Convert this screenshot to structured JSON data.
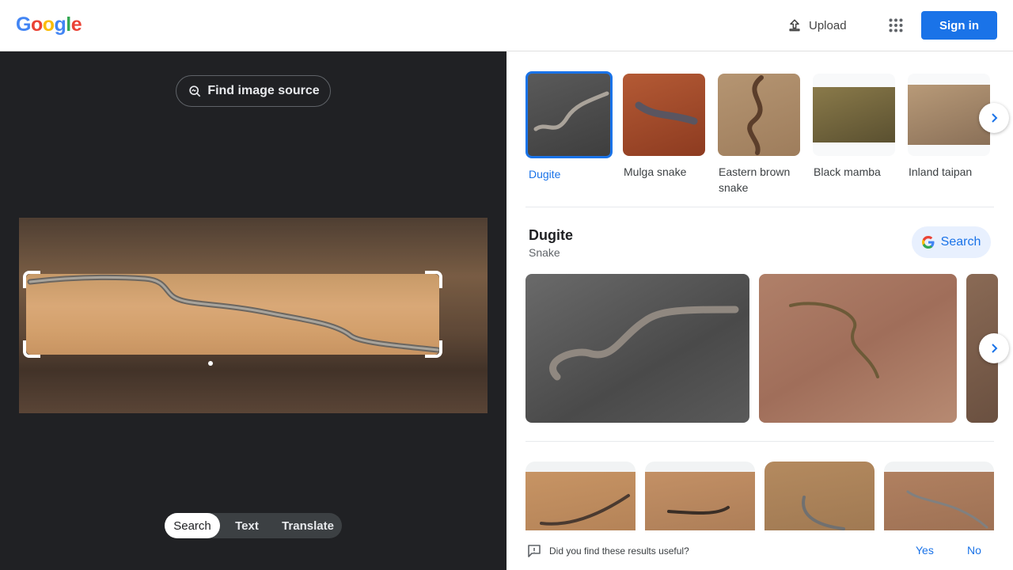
{
  "header": {
    "logo_letters": [
      {
        "char": "G",
        "color": "#4285f4"
      },
      {
        "char": "o",
        "color": "#ea4335"
      },
      {
        "char": "o",
        "color": "#fbbc05"
      },
      {
        "char": "g",
        "color": "#4285f4"
      },
      {
        "char": "l",
        "color": "#34a853"
      },
      {
        "char": "e",
        "color": "#ea4335"
      }
    ],
    "upload_label": "Upload",
    "signin_label": "Sign in"
  },
  "left_panel": {
    "find_source_label": "Find image source",
    "modes": [
      {
        "label": "Search",
        "active": true
      },
      {
        "label": "Text",
        "active": false
      },
      {
        "label": "Translate",
        "active": false
      }
    ]
  },
  "top_matches": [
    {
      "label": "Dugite",
      "selected": true
    },
    {
      "label": "Mulga snake",
      "selected": false
    },
    {
      "label": "Eastern brown snake",
      "selected": false
    },
    {
      "label": "Black mamba",
      "selected": false
    },
    {
      "label": "Inland taipan",
      "selected": false
    }
  ],
  "entity": {
    "title": "Dugite",
    "subtitle": "Snake",
    "search_label": "Search"
  },
  "feedback": {
    "question": "Did you find these results useful?",
    "yes_label": "Yes",
    "no_label": "No"
  },
  "colors": {
    "accent": "#1a73e8",
    "dark_panel": "#202124"
  }
}
